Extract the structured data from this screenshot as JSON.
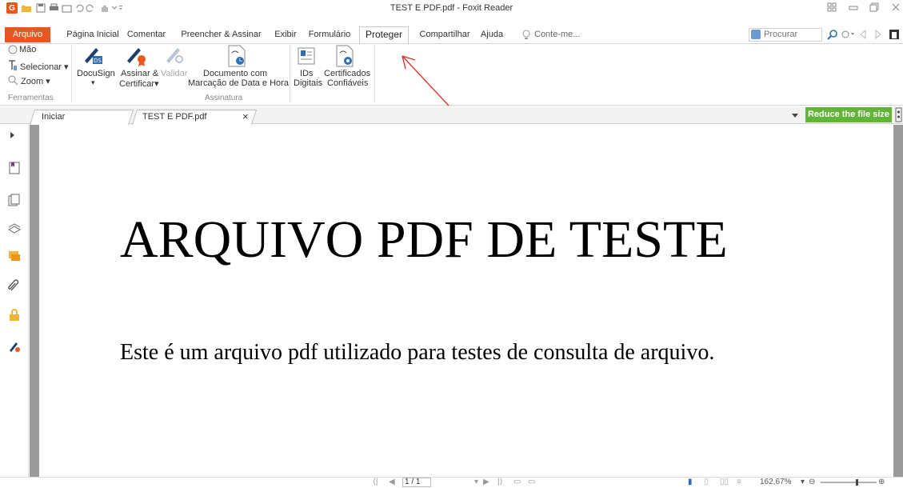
{
  "titlebar": {
    "title": "TEST E PDF.pdf - Foxit Reader",
    "app_logo": "G",
    "quick_access": [
      "open-icon",
      "save-icon",
      "print-icon",
      "email-icon",
      "undo-icon",
      "redo-icon",
      "hand-tool-icon"
    ]
  },
  "menu": {
    "tabs": [
      "Arquivo",
      "Página Inicial",
      "Comentar",
      "Preencher & Assinar",
      "Exibir",
      "Formulário",
      "Proteger",
      "Compartilhar",
      "Ajuda",
      "Conte-me..."
    ],
    "active_tab": "Proteger",
    "search_placeholder": "Procurar"
  },
  "ribbon": {
    "ferramentas": {
      "items": [
        "Mão",
        "Selecionar",
        "Zoom"
      ],
      "group_label": "Ferramentas"
    },
    "assinatura": {
      "docusign": "DocuSign",
      "assinar_line1": "Assinar &",
      "assinar_line2": "Certificar",
      "validar": "Validar",
      "documento_line1": "Documento com",
      "documento_line2": "Marcação de Data e Hora",
      "group_label": "Assinatura"
    },
    "ids": {
      "ids_line1": "IDs",
      "ids_line2": "Digitais",
      "cert_line1": "Certificados",
      "cert_line2": "Confiáveis"
    }
  },
  "doc_tabs": {
    "start_tab": "Iniciar",
    "file_tab": "TEST E PDF.pdf",
    "close_glyph": "×",
    "reduce_button": "Reduce the file size"
  },
  "document": {
    "heading": "ARQUIVO PDF DE TESTE",
    "body": "Este é um arquivo pdf utilizado para testes de consulta de arquivo."
  },
  "statusbar": {
    "page_indicator": "1 / 1",
    "zoom": "162,67%"
  },
  "colors": {
    "accent_orange": "#e8571e",
    "reduce_green": "#62b437",
    "annotation_arrow": "#e0302c"
  }
}
